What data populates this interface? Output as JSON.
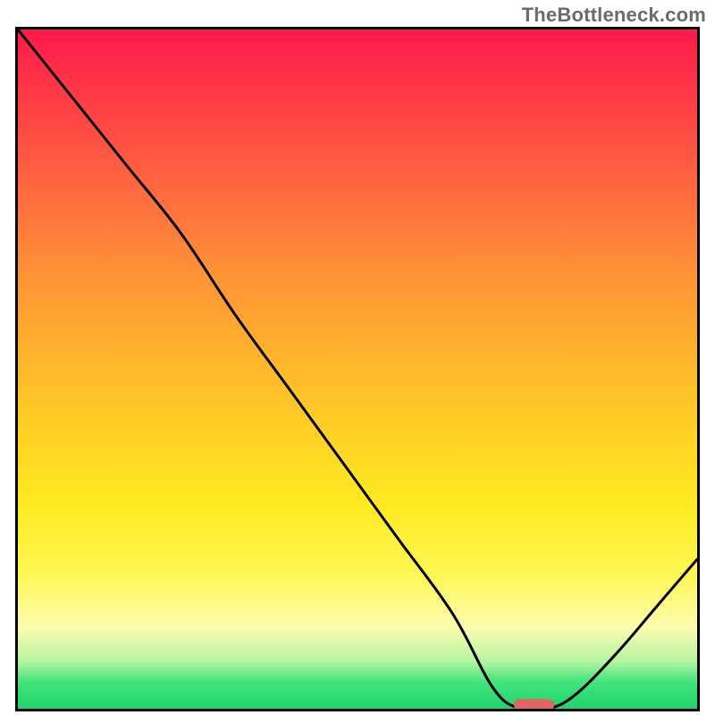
{
  "watermark": "TheBottleneck.com",
  "chart_data": {
    "type": "line",
    "title": "",
    "xlabel": "",
    "ylabel": "",
    "xlim": [
      0,
      100
    ],
    "ylim": [
      0,
      100
    ],
    "grid": false,
    "legend": false,
    "series": [
      {
        "name": "curve",
        "x": [
          0,
          8,
          16,
          24,
          32,
          40,
          48,
          56,
          64,
          70,
          74,
          78,
          82,
          88,
          94,
          100
        ],
        "y": [
          100,
          90,
          80,
          70,
          58,
          47,
          36,
          25,
          14,
          3,
          0,
          0,
          2,
          8,
          15,
          22
        ]
      }
    ],
    "marker": {
      "x_start": 73,
      "x_end": 79,
      "y": 0.5,
      "color": "#e06666"
    },
    "gradient_stops": [
      {
        "pos": 0,
        "color": "#ff1a4b"
      },
      {
        "pos": 24,
        "color": "#ff6a3f"
      },
      {
        "pos": 48,
        "color": "#ffb32c"
      },
      {
        "pos": 70,
        "color": "#ffea22"
      },
      {
        "pos": 88,
        "color": "#fdfcae"
      },
      {
        "pos": 100,
        "color": "#1fd36e"
      }
    ]
  },
  "plot": {
    "inner_w": 760,
    "inner_h": 760,
    "stroke": "#000000",
    "stroke_width": 3
  }
}
